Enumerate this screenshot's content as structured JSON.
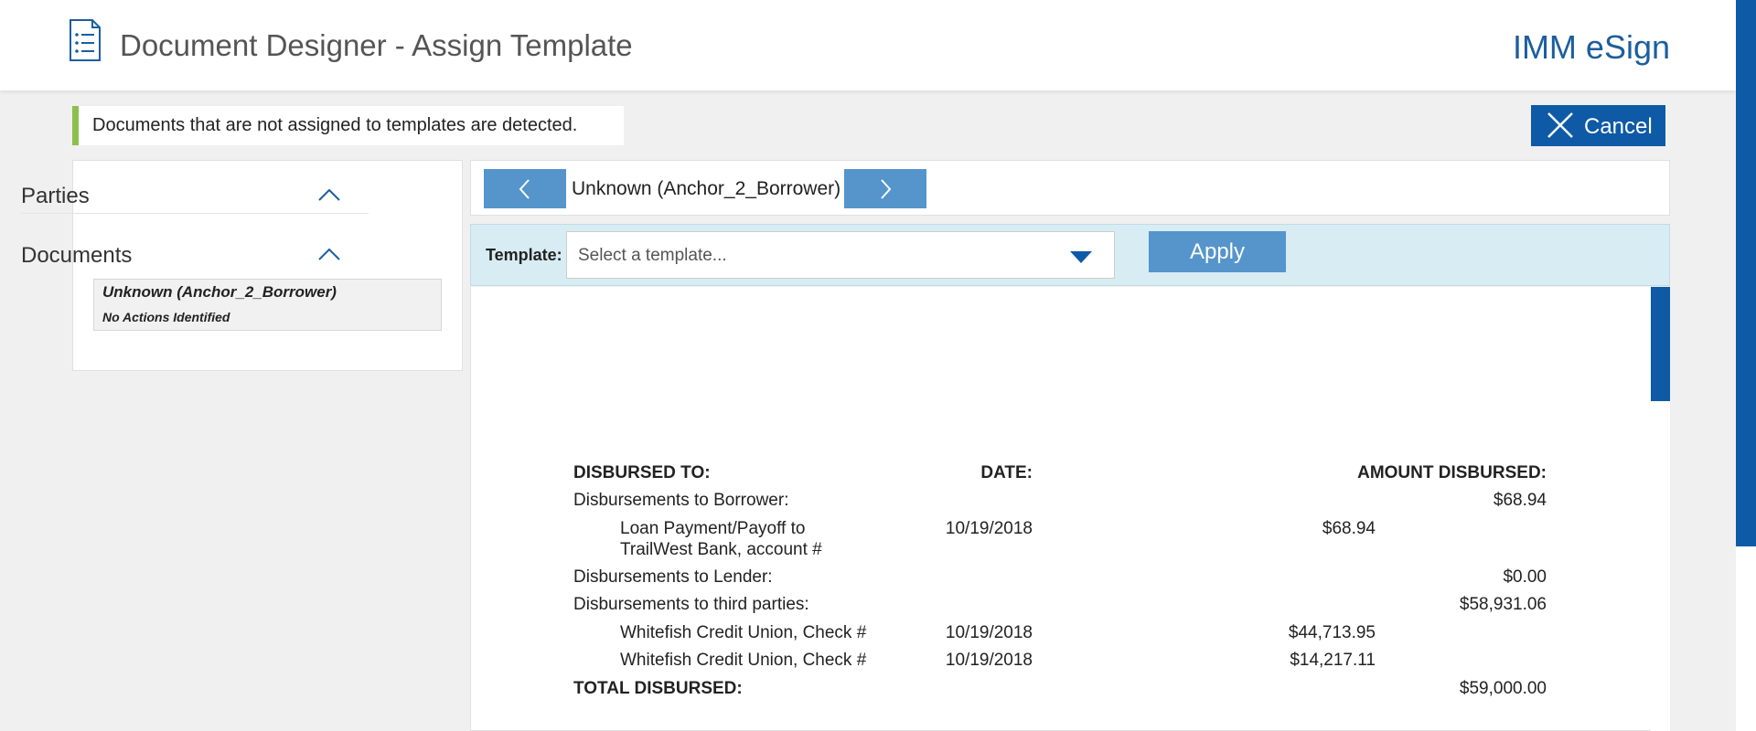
{
  "header": {
    "title": "Document Designer - Assign Template",
    "brand": "IMM eSign",
    "icon": "document-list-icon"
  },
  "alert": {
    "message": "Documents that are not assigned to templates are detected."
  },
  "cancel": {
    "label": "Cancel",
    "icon": "close-icon"
  },
  "sidebar": {
    "sections": [
      {
        "label": "Parties",
        "icon": "chevron-up-icon"
      },
      {
        "label": "Documents",
        "icon": "chevron-up-icon"
      }
    ],
    "documents": [
      {
        "name": "Unknown (Anchor_2_Borrower)",
        "status": "No Actions Identified"
      }
    ]
  },
  "navigator": {
    "current": "Unknown (Anchor_2_Borrower)",
    "prev_icon": "chevron-left-icon",
    "next_icon": "chevron-right-icon"
  },
  "template": {
    "label": "Template:",
    "placeholder": "Select a template...",
    "apply_label": "Apply",
    "dropdown_icon": "caret-down-icon"
  },
  "document": {
    "headers": {
      "to": "DISBURSED TO:",
      "date": "DATE:",
      "amount": "AMOUNT DISBURSED:"
    },
    "rows": [
      {
        "label": "Disbursements to Borrower:",
        "date": "",
        "sub_amount": "",
        "amount": "$68.94"
      },
      {
        "label": "Loan Payment/Payoff to",
        "label2": "TrailWest Bank, account #",
        "date": "10/19/2018",
        "sub_amount": "$68.94",
        "amount": ""
      },
      {
        "label": "Disbursements to Lender:",
        "date": "",
        "sub_amount": "",
        "amount": "$0.00"
      },
      {
        "label": "Disbursements to third parties:",
        "date": "",
        "sub_amount": "",
        "amount": "$58,931.06"
      },
      {
        "label": "Whitefish Credit Union, Check #",
        "date": "10/19/2018",
        "sub_amount": "$44,713.95",
        "amount": ""
      },
      {
        "label": "Whitefish Credit Union, Check #",
        "date": "10/19/2018",
        "sub_amount": "$14,217.11",
        "amount": ""
      },
      {
        "label": "TOTAL DISBURSED:",
        "date": "",
        "sub_amount": "",
        "amount": "$59,000.00"
      }
    ]
  },
  "colors": {
    "primary": "#0e5aa7",
    "button": "#5595cc",
    "alert_bar": "#8cc04c",
    "template_bar": "#d8ecf3"
  }
}
